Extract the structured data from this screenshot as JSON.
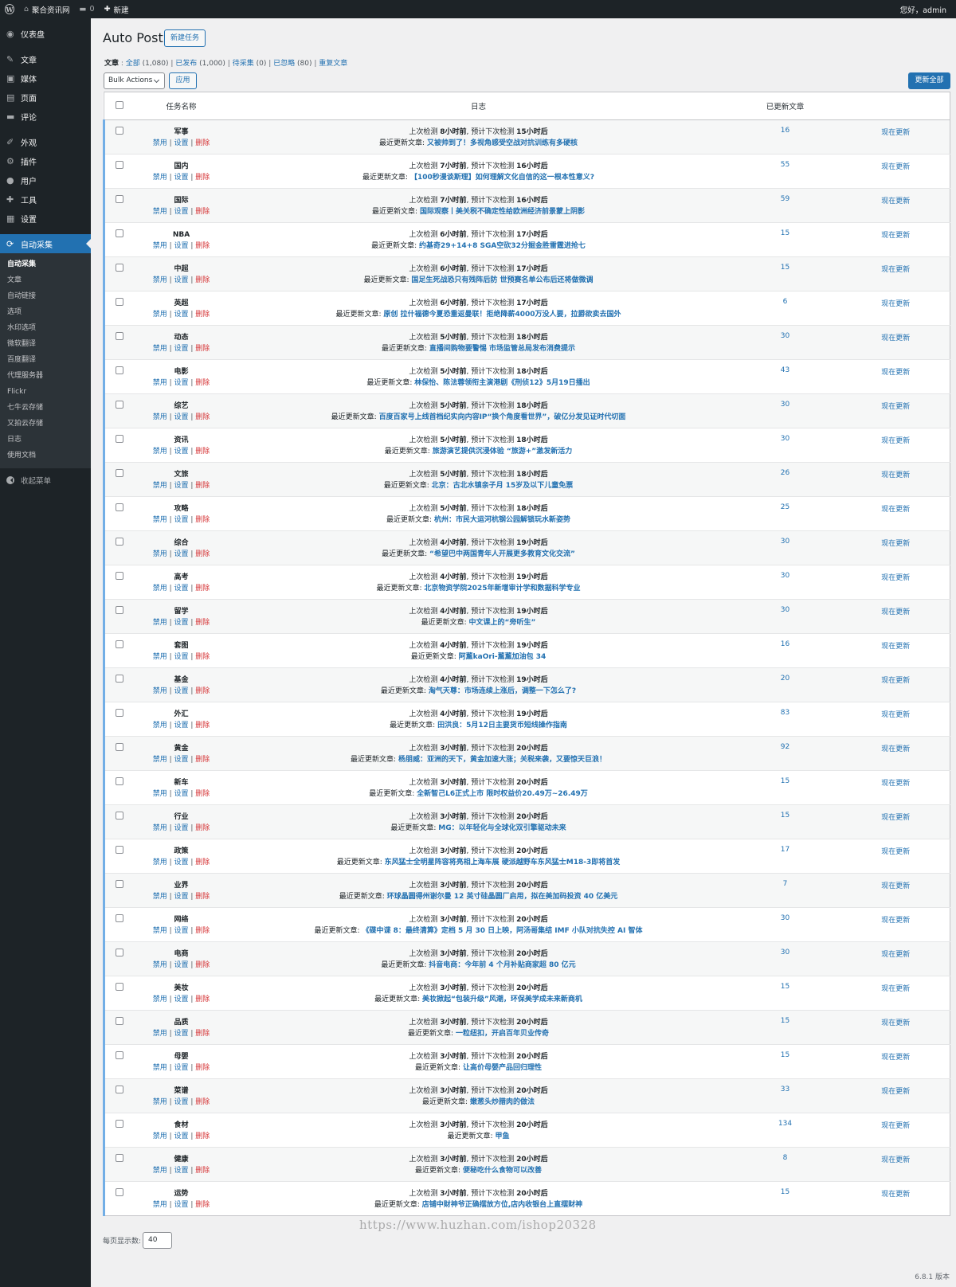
{
  "adminbar": {
    "site": "聚合资讯网",
    "comments": "0",
    "new": "新建",
    "greeting": "您好，admin"
  },
  "sidebar": {
    "items": [
      {
        "icon": "◉",
        "label": "仪表盘",
        "name": "dashboard"
      },
      {
        "icon": "✎",
        "label": "文章",
        "name": "posts"
      },
      {
        "icon": "▣",
        "label": "媒体",
        "name": "media"
      },
      {
        "icon": "▤",
        "label": "页面",
        "name": "pages"
      },
      {
        "icon": "▬",
        "label": "评论",
        "name": "comments"
      },
      {
        "icon": "✐",
        "label": "外观",
        "name": "appearance"
      },
      {
        "icon": "⚙",
        "label": "插件",
        "name": "plugins"
      },
      {
        "icon": "●",
        "label": "用户",
        "name": "users"
      },
      {
        "icon": "✚",
        "label": "工具",
        "name": "tools"
      },
      {
        "icon": "▦",
        "label": "设置",
        "name": "settings"
      },
      {
        "icon": "⟳",
        "label": "自动采集",
        "name": "autopost"
      }
    ],
    "submenu": [
      "自动采集",
      "文章",
      "自动链接",
      "选项",
      "水印选项",
      "微软翻译",
      "百度翻译",
      "代理服务器",
      "Flickr",
      "七牛云存储",
      "又拍云存储",
      "日志",
      "使用文档"
    ],
    "collapse": "收起菜单"
  },
  "page": {
    "title": "Auto Post",
    "add_new": "新建任务"
  },
  "filters": {
    "label": "文章",
    "all": "全部",
    "all_count": "(1,080)",
    "published": "已发布",
    "published_count": "(1,000)",
    "pending": "待采集",
    "pending_count": "(0)",
    "ignored": "已忽略",
    "ignored_count": "(80)",
    "duplicate": "重复文章"
  },
  "toolbar": {
    "bulk": "Bulk Actions",
    "apply": "应用",
    "update_all": "更新全部"
  },
  "table": {
    "headers": [
      "任务名称",
      "日志",
      "已更新文章"
    ],
    "actions": {
      "disable": "禁用",
      "settings": "设置",
      "delete": "删除"
    },
    "log_prefix": "上次检测",
    "log_mid": ", 预计下次检测",
    "recent_label": "最近更新文章:",
    "update_label": "现在更新",
    "rows": [
      {
        "name": "军事",
        "last": "8小时前",
        "next": "15小时后",
        "post": "又被帅到了！多视角感受空战对抗训练有多硬核",
        "count": "16"
      },
      {
        "name": "国内",
        "last": "7小时前",
        "next": "16小时后",
        "post": "【100秒漫谈斯理】如何理解文化自信的这一根本性意义?",
        "count": "55"
      },
      {
        "name": "国际",
        "last": "7小时前",
        "next": "16小时后",
        "post": "国际观察丨美关税不确定性给欧洲经济前景蒙上阴影",
        "count": "59"
      },
      {
        "name": "NBA",
        "last": "6小时前",
        "next": "17小时后",
        "post": "约基奇29+14+8 SGA空砍32分掘金胜雷霆进抢七",
        "count": "15"
      },
      {
        "name": "中超",
        "last": "6小时前",
        "next": "17小时后",
        "post": "国足生死战恐只有残阵后防 世预赛名单公布后还将做微调",
        "count": "15"
      },
      {
        "name": "英超",
        "last": "6小时前",
        "next": "17小时后",
        "post": "原创 拉什福德今夏恐重返曼联！拒绝降薪4000万没人要，拉爵欲卖去国外",
        "count": "6"
      },
      {
        "name": "动态",
        "last": "5小时前",
        "next": "18小时后",
        "post": "直播间购物要警惕 市场监管总局发布消费提示",
        "count": "30"
      },
      {
        "name": "电影",
        "last": "5小时前",
        "next": "18小时后",
        "post": "林保怡、陈法蓉领衔主演港剧《刑侦12》5月19日播出",
        "count": "43"
      },
      {
        "name": "综艺",
        "last": "5小时前",
        "next": "18小时后",
        "post": "百度百家号上线首档纪实向内容IP“换个角度看世界”，破亿分发见证时代切面",
        "count": "30"
      },
      {
        "name": "资讯",
        "last": "5小时前",
        "next": "18小时后",
        "post": "旅游演艺提供沉浸体验 “旅游+”激发新活力",
        "count": "30"
      },
      {
        "name": "文旅",
        "last": "5小时前",
        "next": "18小时后",
        "post": "北京：古北水镇亲子月 15岁及以下儿童免票",
        "count": "26"
      },
      {
        "name": "攻略",
        "last": "5小时前",
        "next": "18小时后",
        "post": "杭州：市民大运河杭钢公园解锁玩水新姿势",
        "count": "25"
      },
      {
        "name": "综合",
        "last": "4小时前",
        "next": "19小时后",
        "post": "“希望巴中两国青年人开展更多教育文化交流”",
        "count": "30"
      },
      {
        "name": "高考",
        "last": "4小时前",
        "next": "19小时后",
        "post": "北京物资学院2025年新增审计学和数据科学专业",
        "count": "30"
      },
      {
        "name": "留学",
        "last": "4小时前",
        "next": "19小时后",
        "post": "中文课上的“旁听生”",
        "count": "30"
      },
      {
        "name": "套图",
        "last": "4小时前",
        "next": "19小时后",
        "post": "阿薰kaOri-薰薰加油包 34",
        "count": "16"
      },
      {
        "name": "基金",
        "last": "4小时前",
        "next": "19小时后",
        "post": "淘气天尊：市场连续上涨后，调整一下怎么了?",
        "count": "20"
      },
      {
        "name": "外汇",
        "last": "4小时前",
        "next": "19小时后",
        "post": "田洪良：5月12日主要货币短线操作指南",
        "count": "83"
      },
      {
        "name": "黄金",
        "last": "3小时前",
        "next": "20小时后",
        "post": "杨朋威：亚洲的天下，黄金加速大涨；关税来袭，又要惊天巨浪！",
        "count": "92"
      },
      {
        "name": "新车",
        "last": "3小时前",
        "next": "20小时后",
        "post": "全新智己L6正式上市 限时权益价20.49万~26.49万",
        "count": "15"
      },
      {
        "name": "行业",
        "last": "3小时前",
        "next": "20小时后",
        "post": "MG：以年轻化与全球化双引擎驱动未来",
        "count": "15"
      },
      {
        "name": "政策",
        "last": "3小时前",
        "next": "20小时后",
        "post": "东风猛士全明星阵容将亮相上海车展 硬派越野车东风猛士M18-3即将首发",
        "count": "17"
      },
      {
        "name": "业界",
        "last": "3小时前",
        "next": "20小时后",
        "post": "环球晶圆得州谢尔曼 12 英寸硅晶圆厂启用，拟在美加码投资 40 亿美元",
        "count": "7"
      },
      {
        "name": "网络",
        "last": "3小时前",
        "next": "20小时后",
        "post": "《碟中谍 8：最终清算》定档 5 月 30 日上映，阿汤哥集结 IMF 小队对抗失控 AI 智体",
        "count": "30"
      },
      {
        "name": "电商",
        "last": "3小时前",
        "next": "20小时后",
        "post": "抖音电商：今年前 4 个月补贴商家超 80 亿元",
        "count": "30"
      },
      {
        "name": "美妆",
        "last": "3小时前",
        "next": "20小时后",
        "post": "美妆掀起“包装升级”风潮，环保美学成未来新商机",
        "count": "15"
      },
      {
        "name": "品质",
        "last": "3小时前",
        "next": "20小时后",
        "post": "一粒纽扣，开启百年贝业传奇",
        "count": "15"
      },
      {
        "name": "母婴",
        "last": "3小时前",
        "next": "20小时后",
        "post": "让高价母婴产品回归理性",
        "count": "15"
      },
      {
        "name": "菜谱",
        "last": "3小时前",
        "next": "20小时后",
        "post": "嫩葱头炒腊肉的做法",
        "count": "33"
      },
      {
        "name": "食材",
        "last": "3小时前",
        "next": "20小时后",
        "post": "甲鱼",
        "count": "134"
      },
      {
        "name": "健康",
        "last": "3小时前",
        "next": "20小时后",
        "post": "便秘吃什么食物可以改善",
        "count": "8"
      },
      {
        "name": "运势",
        "last": "3小时前",
        "next": "20小时后",
        "post": "店铺中财神爷正确摆放方位,店内收银台上直摆财神",
        "count": "15"
      }
    ]
  },
  "footer": {
    "per_page_label": "每页显示数:",
    "per_page": "40",
    "watermark": "https://www.huzhan.com/ishop20328",
    "version": "6.8.1 版本"
  }
}
